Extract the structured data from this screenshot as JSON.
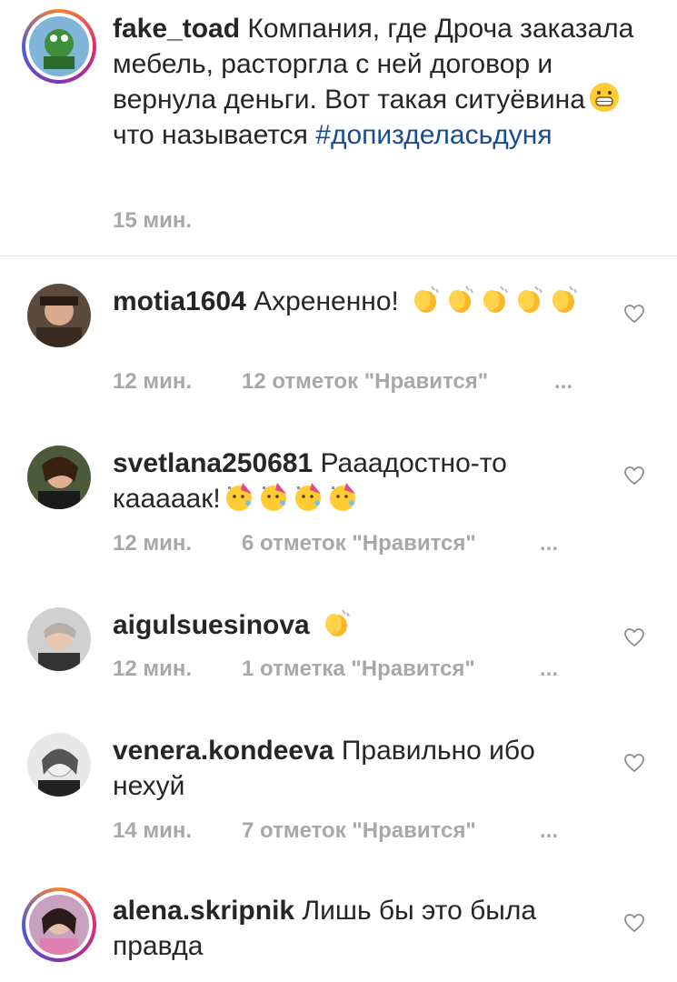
{
  "caption": {
    "username": "fake_toad",
    "text": "Компания, где Дроча заказала мебель,  расторгла с ней договор и вернула деньги. Вот такая ситуёвина",
    "text_after_emoji": " что называется",
    "hashtag": "#допизделасьдуня",
    "time": "15 мин.",
    "emoji": "grinning-face-emoji"
  },
  "comments": [
    {
      "username": "motia1604",
      "text": "Ахрененно!",
      "emoji": "clapping-hands-emoji",
      "emoji_count": 5,
      "time": "12 мин.",
      "likes": "12 отметок \"Нравится\"",
      "more": "..."
    },
    {
      "username": "svetlana250681",
      "text": "Рааадостно-то кааааак!",
      "emoji": "partying-face-emoji",
      "emoji_count": 4,
      "time": "12 мин.",
      "likes": "6 отметок \"Нравится\"",
      "more": "..."
    },
    {
      "username": "aigulsuesinova",
      "text": "",
      "emoji": "clapping-hands-emoji",
      "emoji_count": 1,
      "time": "12 мин.",
      "likes": "1 отметка \"Нравится\"",
      "more": "..."
    },
    {
      "username": "venera.kondeeva",
      "text": "Правильно ибо нехуй",
      "emoji": "",
      "emoji_count": 0,
      "time": "14 мин.",
      "likes": "7 отметок \"Нравится\"",
      "more": "..."
    },
    {
      "username": "alena.skripnik",
      "text": "Лишь бы это была правда",
      "emoji": "",
      "emoji_count": 0,
      "time": "",
      "likes": "",
      "more": ""
    }
  ],
  "colors": {
    "hashtag": "#1a4d8f",
    "meta": "#a8a8a8",
    "text": "#262626"
  }
}
